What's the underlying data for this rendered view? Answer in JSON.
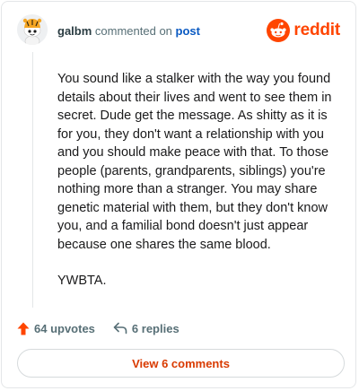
{
  "header": {
    "username": "galbm",
    "action_text": "commented on",
    "post_link": "post",
    "brand": "reddit"
  },
  "comment": {
    "paragraphs": [
      "You sound like a stalker with the way you found details about their lives and went to see them in secret. Dude get the message. As shitty as it is for you, they don't want a relationship with you and you should make peace with that. To those people (parents, grandparents, siblings) you're nothing more than a stranger. You may share genetic material with them, but they don't know you, and a familial bond doesn't just appear because one shares the same blood.",
      "YWBTA."
    ]
  },
  "actions": {
    "upvotes": "64 upvotes",
    "replies": "6 replies"
  },
  "footer": {
    "view_comments": "View 6 comments"
  },
  "colors": {
    "brand": "#ff4500",
    "link": "#0a5ac2",
    "view_button_text": "#d93a00"
  },
  "icons": [
    "avatar",
    "reddit-snoo-icon",
    "upvote-arrow-icon",
    "reply-icon"
  ]
}
